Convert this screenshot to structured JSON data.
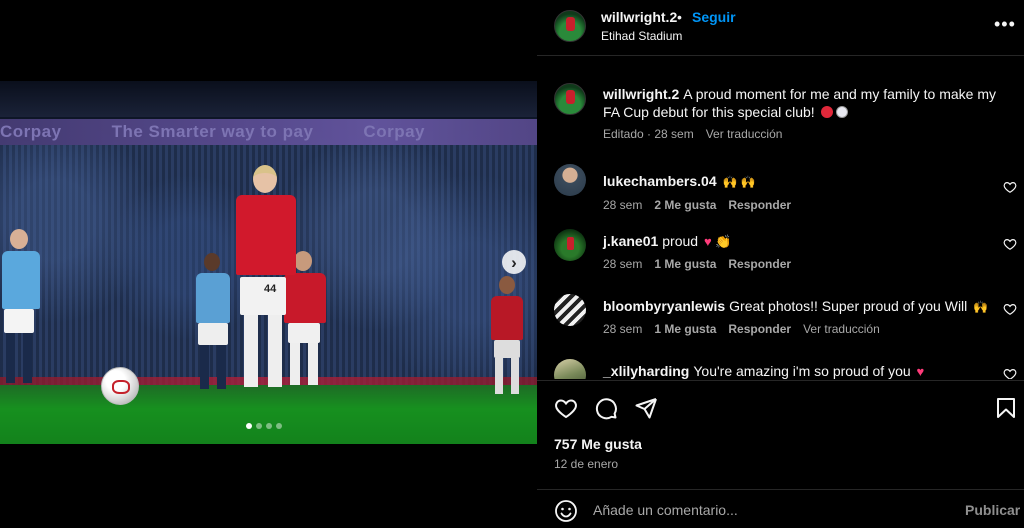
{
  "post": {
    "username": "willwright.2",
    "follow_label": "Seguir",
    "location": "Etihad Stadium",
    "more_label": "•••",
    "banner_texts": [
      "Corpay",
      "The Smarter way to pay",
      "Corpay"
    ],
    "player_number": "44",
    "next_label": "›"
  },
  "caption": {
    "username": "willwright.2",
    "text": "A proud moment for me and my family to make my FA Cup debut for this special club!",
    "meta_edited": "Editado · 28 sem",
    "meta_translate": "Ver traducción"
  },
  "comments": [
    {
      "username": "lukechambers.04",
      "text": "",
      "emoji": "🙌 🙌",
      "time": "28 sem",
      "likes": "2 Me gusta",
      "reply": "Responder",
      "translate": ""
    },
    {
      "username": "j.kane01",
      "text": "proud",
      "emoji": "♥ 👏",
      "time": "28 sem",
      "likes": "1 Me gusta",
      "reply": "Responder",
      "translate": ""
    },
    {
      "username": "bloombyryanlewis",
      "text": "Great photos!! Super proud of you Will",
      "emoji": "🙌",
      "time": "28 sem",
      "likes": "1 Me gusta",
      "reply": "Responder",
      "translate": "Ver traducción"
    },
    {
      "username": "_xlilyharding",
      "text": "You're amazing i'm so proud of you",
      "emoji": "♥",
      "time": "",
      "likes": "",
      "reply": "",
      "translate": ""
    }
  ],
  "stats": {
    "likes": "757 Me gusta",
    "date": "12 de enero"
  },
  "composer": {
    "placeholder": "Añade un comentario...",
    "publish": "Publicar"
  },
  "carousel": {
    "total": 4,
    "active": 1
  }
}
